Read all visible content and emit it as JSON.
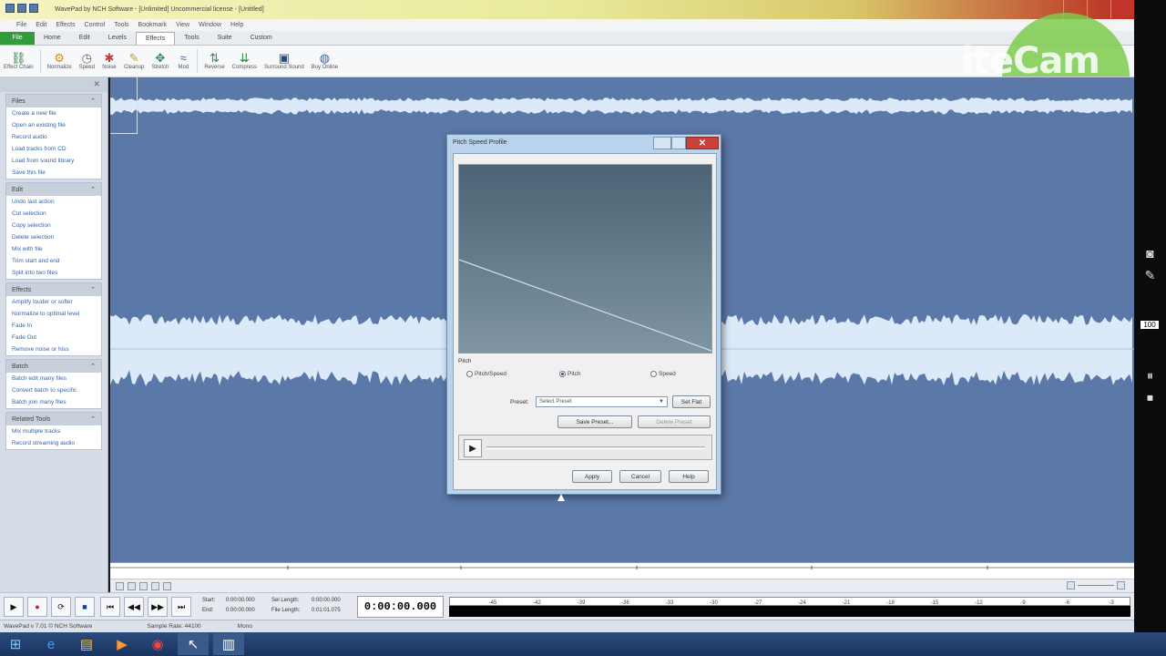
{
  "app": {
    "title": "WavePad by NCH Software - [Unlimited] Uncommercial license - [Untitled]",
    "menu": [
      "File",
      "Edit",
      "Effects",
      "Control",
      "Tools",
      "Bookmark",
      "View",
      "Window",
      "Help"
    ],
    "tabs": [
      "File",
      "Home",
      "Edit",
      "Levels",
      "Effects",
      "Tools",
      "Suite",
      "Custom"
    ],
    "active_tab": "Effects"
  },
  "ribbon": {
    "buttons": [
      {
        "label": "Effect Chain",
        "icon": "chain-icon"
      },
      {
        "label": "Normalize",
        "icon": "normalize-icon"
      },
      {
        "label": "Speed",
        "icon": "speed-icon"
      },
      {
        "label": "Noise",
        "icon": "noise-icon"
      },
      {
        "label": "Cleanup",
        "icon": "cleanup-icon"
      },
      {
        "label": "Stretch",
        "icon": "stretch-icon"
      },
      {
        "label": "Mod",
        "icon": "mod-icon"
      },
      {
        "label": "Reverse",
        "icon": "reverse-icon"
      },
      {
        "label": "Compress",
        "icon": "compress-icon"
      },
      {
        "label": "Surround Sound",
        "icon": "surround-icon"
      },
      {
        "label": "Buy Online",
        "icon": "globe-icon"
      }
    ]
  },
  "sidebar": {
    "panels": [
      {
        "title": "Files",
        "items": [
          "Create a new file",
          "Open an existing file",
          "Record audio",
          "Load tracks from CD",
          "Load from sound library",
          "Save this file"
        ]
      },
      {
        "title": "Edit",
        "items": [
          "Undo last action",
          "Cut selection",
          "Copy selection",
          "Delete selection",
          "Mix with file",
          "Trim start and end",
          "Split into two files"
        ]
      },
      {
        "title": "Effects",
        "items": [
          "Amplify louder or softer",
          "Normalize to optimal level",
          "Fade In",
          "Fade Out",
          "Remove noise or hiss"
        ]
      },
      {
        "title": "Batch",
        "items": [
          "Batch edit many files",
          "Convert batch to specific",
          "Batch join many files"
        ]
      },
      {
        "title": "Related Tools",
        "items": [
          "Mix multiple tracks",
          "Record streaming audio"
        ]
      }
    ]
  },
  "dialog": {
    "title": "Pitch Speed Profile",
    "group_label": "Pitch",
    "radio_options": [
      "Pitch/Speed",
      "Pitch",
      "Speed"
    ],
    "selected_option": "Pitch",
    "preset_label": "Preset:",
    "preset_value": "Select Preset",
    "set_flat": "Set Flat",
    "save_preset": "Save Preset...",
    "delete_preset": "Delete Preset",
    "apply": "Apply",
    "cancel": "Cancel",
    "help": "Help"
  },
  "transport": {
    "start_label": "Start:",
    "start_value": "0:00:00.000",
    "end_label": "End:",
    "end_value": "0:00:00.000",
    "sel_length_label": "Sel Length:",
    "sel_length_value": "0:00:00.000",
    "file_length_label": "File Length:",
    "file_length_value": "0:01:01.075",
    "time": "0:00:00.000",
    "meter_ticks": [
      "-45",
      "-42",
      "-39",
      "-36",
      "-33",
      "-30",
      "-27",
      "-24",
      "-21",
      "-18",
      "-15",
      "-12",
      "-9",
      "-6",
      "-3",
      "0"
    ]
  },
  "statusbar": {
    "app": "WavePad v 7.01 © NCH Software",
    "sample_rate": "Sample Rate: 44100",
    "channels": "Mono"
  },
  "overlay": {
    "logo_text": "iteCam",
    "zoom": "100"
  },
  "colors": {
    "waveform_bg": "#5b79a8",
    "waveform_fg": "#dce9f8",
    "file_tab": "#2f9e3a",
    "close_button": "#c8423a"
  }
}
